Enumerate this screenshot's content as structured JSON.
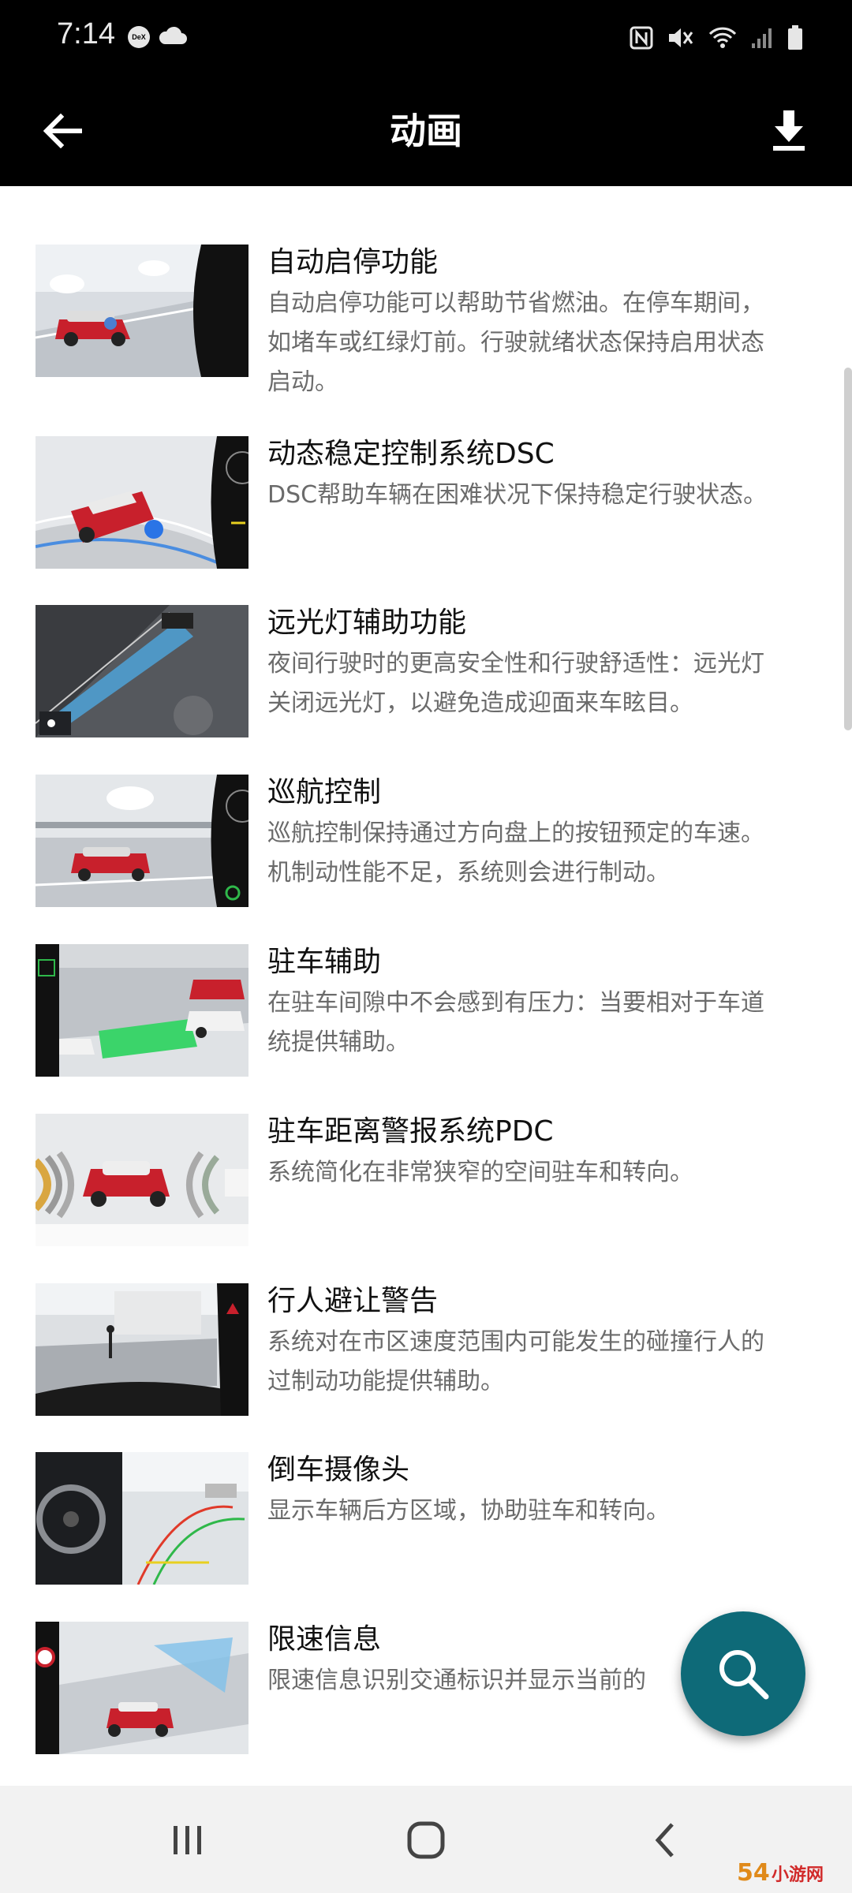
{
  "status_bar": {
    "time": "7:14",
    "dex_label": "DeX",
    "icons": [
      "dex-icon",
      "cloud-icon",
      "nfc-icon",
      "mute-icon",
      "wifi-icon",
      "signal-icon",
      "battery-icon"
    ]
  },
  "app_bar": {
    "title": "动画",
    "back_icon": "arrow-left-icon",
    "download_icon": "download-icon"
  },
  "items": [
    {
      "title": "自动启停功能",
      "desc": [
        "自动启停功能可以帮助节省燃油。在停车期间，",
        "如堵车或红绿灯前。行驶就绪状态保持启用状态",
        "启动。"
      ]
    },
    {
      "title": "动态稳定控制系统DSC",
      "desc": [
        "DSC帮助车辆在困难状况下保持稳定行驶状态。"
      ]
    },
    {
      "title": "远光灯辅助功能",
      "desc": [
        "夜间行驶时的更高安全性和行驶舒适性：远光灯",
        "关闭远光灯，以避免造成迎面来车眩目。"
      ]
    },
    {
      "title": "巡航控制",
      "desc": [
        "巡航控制保持通过方向盘上的按钮预定的车速。",
        "机制动性能不足，系统则会进行制动。"
      ]
    },
    {
      "title": "驻车辅助",
      "desc": [
        "在驻车间隙中不会感到有压力：当要相对于车道",
        "统提供辅助。"
      ]
    },
    {
      "title": "驻车距离警报系统PDC",
      "desc": [
        "系统简化在非常狭窄的空间驻车和转向。"
      ]
    },
    {
      "title": "行人避让警告",
      "desc": [
        "系统对在市区速度范围内可能发生的碰撞行人的",
        "过制动功能提供辅助。"
      ]
    },
    {
      "title": "倒车摄像头",
      "desc": [
        "显示车辆后方区域，协助驻车和转向。"
      ]
    },
    {
      "title": "限速信息",
      "desc": [
        "限速信息识别交通标识并显示当前的"
      ]
    }
  ],
  "fab": {
    "icon": "search-icon"
  },
  "nav_bar": {
    "icons": [
      "recents-icon",
      "home-icon",
      "back-icon"
    ]
  },
  "watermark": {
    "text": "54小游网"
  },
  "colors": {
    "bar_bg": "#000000",
    "fab": "#0e6a78",
    "car_red": "#c8202c"
  }
}
